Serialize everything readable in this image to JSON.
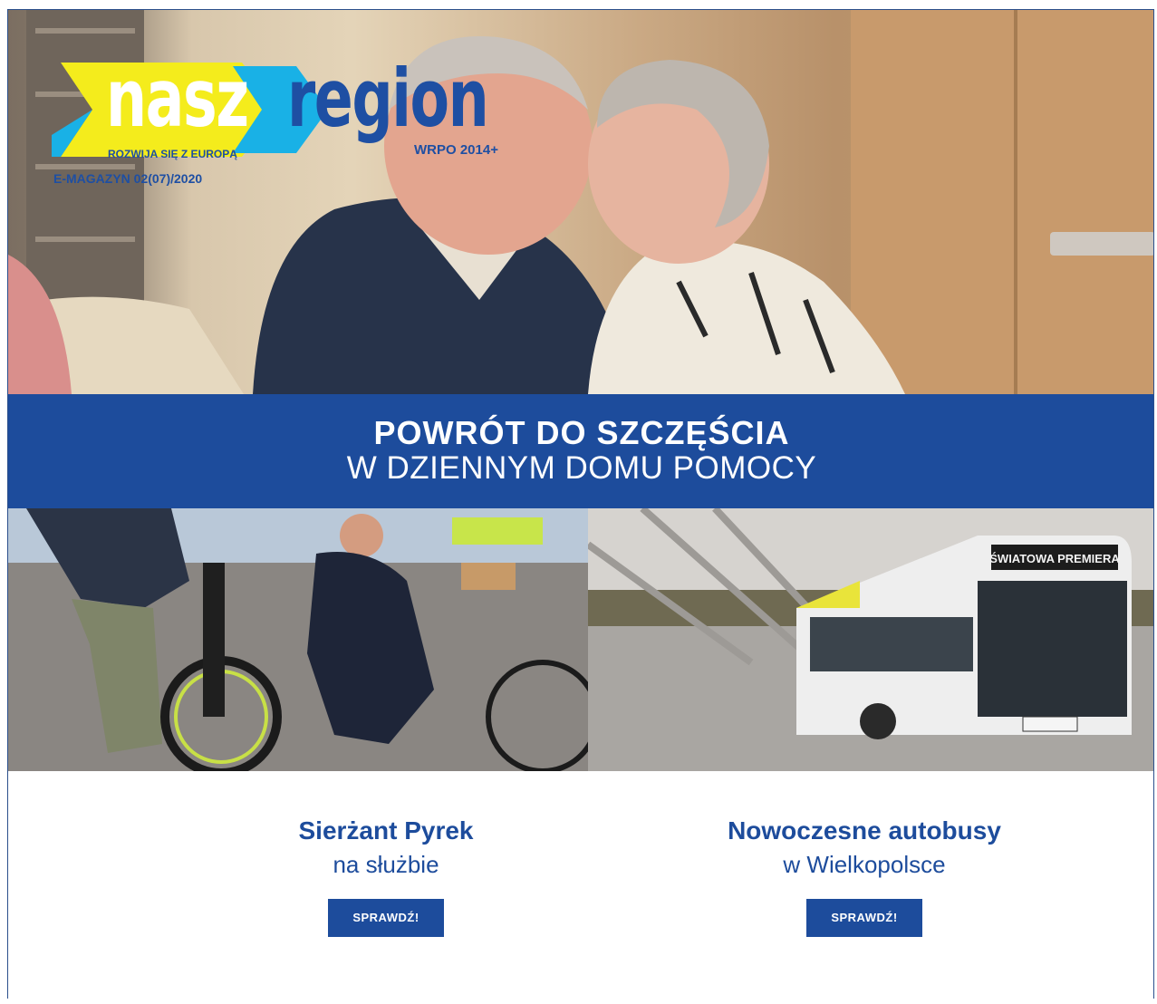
{
  "logo": {
    "word1": "nasz",
    "word2": "region",
    "tagline": "ROZWIJA SIĘ Z EUROPĄ",
    "program": "WRPO 2014+",
    "issue": "E-MAGAZYN 02(07)/2020"
  },
  "hero": {
    "image": "elderly-couple-kiss-photo"
  },
  "banner": {
    "title": "POWRÓT DO SZCZĘŚCIA",
    "subtitle": "W DZIENNYM DOMU POMOCY"
  },
  "articles": [
    {
      "image": "police-officer-bicycle-photo",
      "title": "Sierżant Pyrek",
      "subtitle": "na służbie",
      "button": "SPRAWDŹ!"
    },
    {
      "image": "bus-premiere-photo",
      "title": "Nowoczesne autobusy",
      "subtitle": "w Wielkopolsce",
      "button": "SPRAWDŹ!",
      "bus_sign": "ŚWIATOWA PREMIERA"
    }
  ],
  "colors": {
    "brand_blue": "#1d4c9c",
    "logo_yellow": "#f4ec1c",
    "logo_cyan": "#19b1e6"
  }
}
